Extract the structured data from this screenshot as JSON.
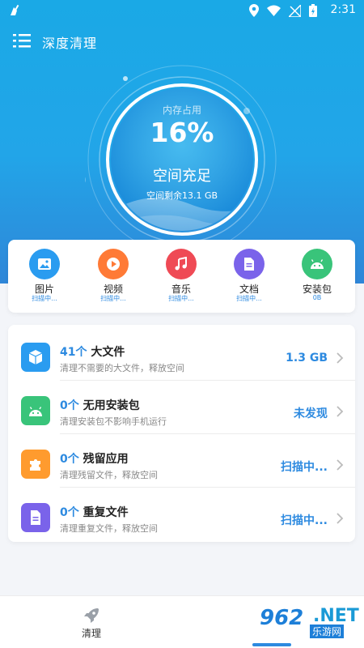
{
  "status_bar": {
    "time": "2:31"
  },
  "app": {
    "title": "深度清理"
  },
  "gauge": {
    "label": "内存占用",
    "percent": "16%",
    "status": "空间充足",
    "remaining": "空间剩余13.1 GB"
  },
  "categories": [
    {
      "name": "图片",
      "sub": "扫描中...",
      "icon": "image-icon",
      "color": "#2a9cf0"
    },
    {
      "name": "视频",
      "sub": "扫描中...",
      "icon": "play-icon",
      "color": "#ff7a36"
    },
    {
      "name": "音乐",
      "sub": "扫描中...",
      "icon": "music-icon",
      "color": "#ef4a55"
    },
    {
      "name": "文档",
      "sub": "扫描中...",
      "icon": "document-icon",
      "color": "#7a63ea"
    },
    {
      "name": "安装包",
      "sub": "0B",
      "icon": "android-icon",
      "color": "#39c47a"
    }
  ],
  "rows": [
    {
      "count": "41个",
      "title": "大文件",
      "desc": "清理不需要的大文件，释放空间",
      "value": "1.3 GB",
      "icon": "cube-icon",
      "color": "#2a9cf0"
    },
    {
      "count": "0个",
      "title": "无用安装包",
      "desc": "清理安装包不影响手机运行",
      "value": "未发现",
      "icon": "android-icon",
      "color": "#39c47a"
    },
    {
      "count": "0个",
      "title": "残留应用",
      "desc": "清理残留文件，释放空间",
      "value": "扫描中...",
      "icon": "puzzle-icon",
      "color": "#ff9b2e"
    },
    {
      "count": "0个",
      "title": "重复文件",
      "desc": "清理重复文件，释放空间",
      "value": "扫描中...",
      "icon": "document-icon",
      "color": "#7a63ea"
    }
  ],
  "nav": {
    "clean_label": "清理"
  },
  "watermark": {
    "num": "962",
    "net": ".NET",
    "sub": "乐游网"
  },
  "colors": {
    "accent": "#2d8ae0",
    "header_top": "#1aa9e6"
  }
}
